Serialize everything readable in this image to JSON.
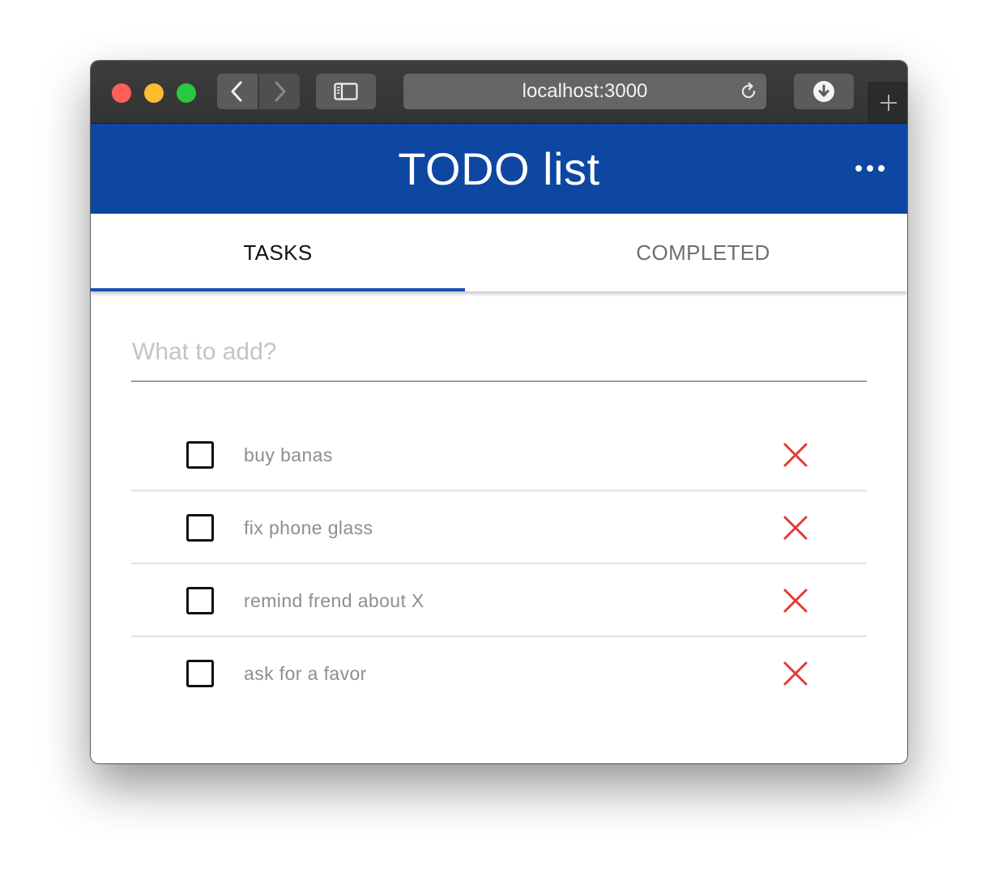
{
  "browser": {
    "url": "localhost:3000"
  },
  "app": {
    "title": "TODO list"
  },
  "tabs": [
    {
      "label": "TASKS",
      "active": true
    },
    {
      "label": "COMPLETED",
      "active": false
    }
  ],
  "add_task": {
    "placeholder": "What to add?",
    "value": ""
  },
  "tasks": [
    {
      "text": "buy banas",
      "done": false
    },
    {
      "text": "fix phone glass",
      "done": false
    },
    {
      "text": "remind frend about X",
      "done": false
    },
    {
      "text": "ask for a favor",
      "done": false
    }
  ],
  "icons": {
    "back": "chevron-left-icon",
    "forward": "chevron-right-icon",
    "sidebar": "sidebar-icon",
    "reload": "reload-icon",
    "download": "download-icon",
    "new_tab": "plus-icon",
    "more": "more-horizontal-icon",
    "delete": "close-icon",
    "checkbox": "checkbox-unchecked-icon"
  },
  "colors": {
    "header": "#0d47a1",
    "tab_indicator": "#1e4fb3",
    "delete": "#e53935",
    "close_dot": "#fe5f57",
    "minimize_dot": "#febc2e",
    "zoom_dot": "#28c840"
  }
}
